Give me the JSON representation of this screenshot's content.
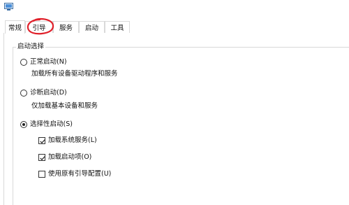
{
  "window": {
    "icon": "system-config-icon"
  },
  "tabs": [
    {
      "label": "常规",
      "active": true
    },
    {
      "label": "引导",
      "active": false
    },
    {
      "label": "服务",
      "active": false
    },
    {
      "label": "启动",
      "active": false
    },
    {
      "label": "工具",
      "active": false
    }
  ],
  "annotation": {
    "shape": "hand-drawn circle",
    "color": "#e0202a"
  },
  "startup_selection": {
    "title": "启动选择",
    "normal": {
      "label": "正常启动(N)",
      "description": "加载所有设备驱动程序和服务",
      "selected": false
    },
    "diagnostic": {
      "label": "诊断启动(D)",
      "description": "仅加载基本设备和服务",
      "selected": false
    },
    "selective": {
      "label": "选择性启动(S)",
      "selected": true
    },
    "options": [
      {
        "label": "加载系统服务(L)",
        "checked": true
      },
      {
        "label": "加载启动项(O)",
        "checked": true
      },
      {
        "label": "使用原有引导配置(U)",
        "checked": false
      }
    ]
  }
}
